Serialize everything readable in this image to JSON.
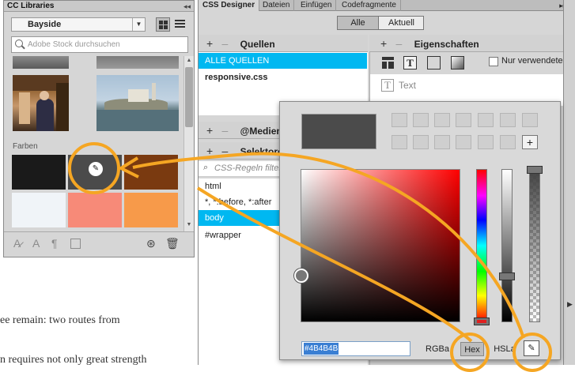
{
  "document": {
    "lines": [
      "ee remain: two routes from",
      "n requires not only great strength"
    ]
  },
  "cc_libraries": {
    "title": "CC Libraries",
    "library_select": "Bayside",
    "search_placeholder": "Adobe Stock durchsuchen",
    "colors_section_label": "Farben",
    "swatches": [
      "#1a1a1a",
      "#4b4b4b",
      "#7a3a10",
      "#f0f4f8",
      "#f78a78",
      "#f79a4a"
    ],
    "footer_icons": [
      "text-style-icon",
      "character-style-icon",
      "paragraph-style-icon",
      "graphic-icon",
      "creative-cloud-icon",
      "trash-icon"
    ]
  },
  "css_designer": {
    "tabs": [
      "CSS Designer",
      "Dateien",
      "Einfügen",
      "Codefragmente"
    ],
    "scope_all": "Alle",
    "scope_current": "Aktuell",
    "sources": {
      "header": "Quellen",
      "items": [
        "ALLE QUELLEN",
        "responsive.css"
      ]
    },
    "media": {
      "header": "@Medien"
    },
    "selectors": {
      "header": "Selektoren",
      "filter_placeholder": "CSS-Regeln filtern",
      "items": [
        "html",
        "*, *:before, *:after",
        "body",
        "#wrapper"
      ]
    },
    "properties": {
      "header": "Eigenschaften",
      "show_used_label": "Nur verwendete",
      "text_group": "Text"
    }
  },
  "color_picker": {
    "current_color": "#4B4B4B",
    "hex_value": "#4B4B4B",
    "modes": [
      "RGBa",
      "Hex",
      "HSLa"
    ],
    "active_mode": "Hex",
    "hue_level": 0.0,
    "brightness_level": 0.3,
    "alpha_level": 1.0,
    "colors": {
      "accent": "#00b8f1",
      "annotation": "#f5a623"
    }
  }
}
